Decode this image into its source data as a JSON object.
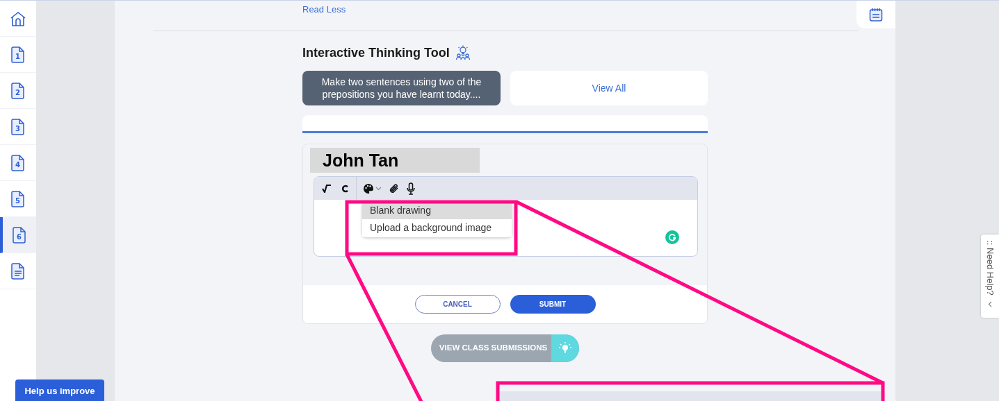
{
  "sidebar": {
    "items": [
      {
        "kind": "home",
        "selected": false
      },
      {
        "kind": "page",
        "label": "1",
        "selected": false
      },
      {
        "kind": "page",
        "label": "2",
        "selected": false
      },
      {
        "kind": "page",
        "label": "3",
        "selected": false
      },
      {
        "kind": "page",
        "label": "4",
        "selected": false
      },
      {
        "kind": "page",
        "label": "5",
        "selected": false
      },
      {
        "kind": "page",
        "label": "6",
        "selected": true
      },
      {
        "kind": "notes",
        "selected": false
      }
    ]
  },
  "read_less": "Read Less",
  "tool": {
    "title": "Interactive Thinking Tool",
    "prompt": "Make two sentences using two of the prepositions you have learnt today....",
    "view_all": "View All",
    "student_name": "John Tan",
    "menu": [
      {
        "label": "Blank drawing",
        "selected": true
      },
      {
        "label": "Upload a background image",
        "selected": false
      }
    ],
    "buttons": [
      {
        "kind": "outline",
        "label": "CANCEL"
      },
      {
        "kind": "primary",
        "label": "SUBMIT"
      }
    ],
    "view_submissions": "VIEW CLASS SUBMISSIONS"
  },
  "help_improve": "Help us improve",
  "need_help": ":: Need Help?"
}
